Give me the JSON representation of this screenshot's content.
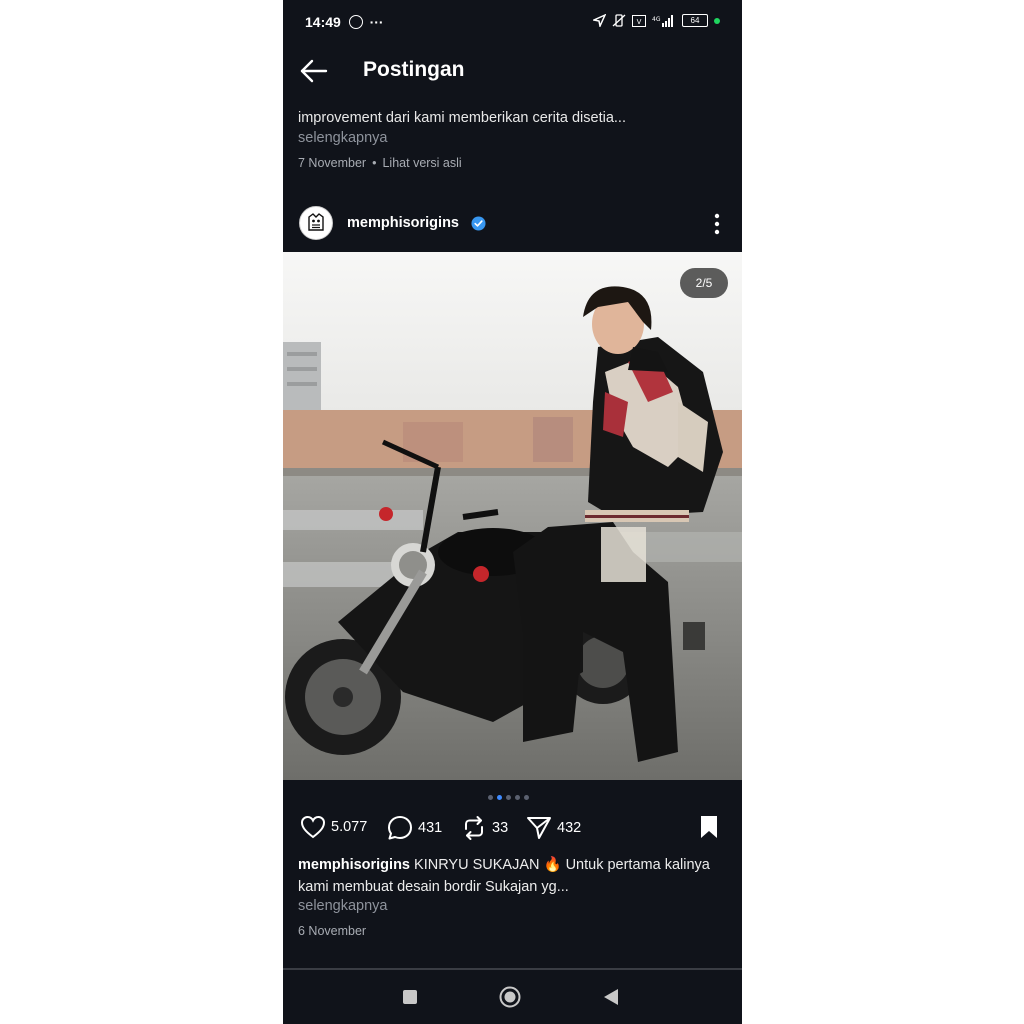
{
  "status_bar": {
    "time": "14:49",
    "extra": "···",
    "battery": "64"
  },
  "header": {
    "title": "Postingan"
  },
  "previous_post": {
    "caption": "improvement dari kami memberikan cerita disetia...",
    "more": "selengkapnya",
    "date": "7 November",
    "original_link": "Lihat versi asli"
  },
  "post": {
    "username": "memphisorigins",
    "counter": "2/5",
    "carousel": {
      "count": 5,
      "active_index": 1
    },
    "stats": {
      "likes": "5.077",
      "comments": "431",
      "reposts": "33",
      "shares": "432"
    },
    "caption_user": "memphisorigins",
    "caption_text": " KINRYU SUKAJAN 🔥 Untuk pertama kalinya kami membuat desain bordir Sukajan yg...",
    "more": "selengkapnya",
    "date": "6 November"
  },
  "colors": {
    "background": "#10131a",
    "verified": "#3897f0",
    "active_dot": "#3f8bff",
    "online": "#1fd65f"
  }
}
